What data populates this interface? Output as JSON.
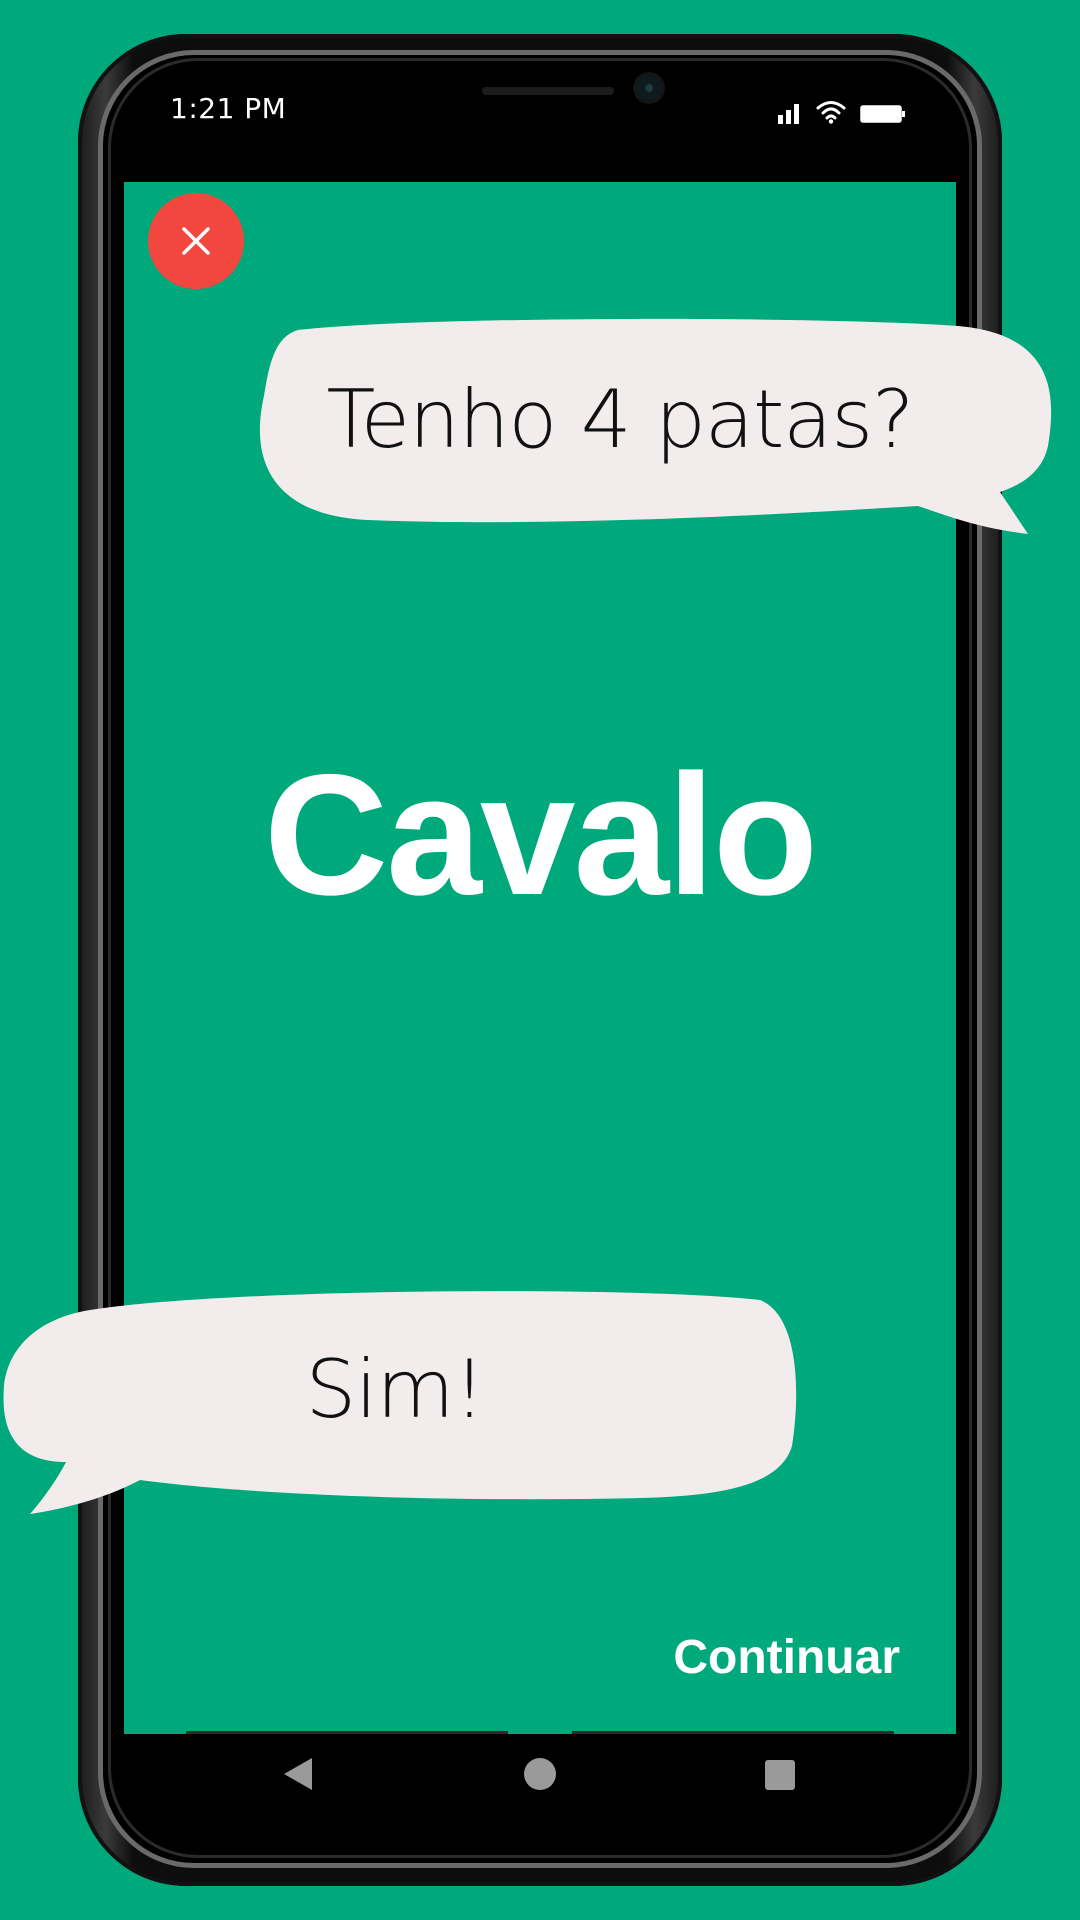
{
  "status_bar": {
    "time": "1:21 PM",
    "icons": [
      "signal-icon",
      "wifi-icon",
      "battery-icon"
    ]
  },
  "close_button": {
    "icon": "close-icon",
    "color": "#F2473F"
  },
  "question_bubble": {
    "text": "Tenho 4 patas?"
  },
  "main_word": "Cavalo",
  "answer_bubble": {
    "text": "Sim!"
  },
  "continue_button": {
    "label": "Continuar"
  },
  "navigation_bar": {
    "items": [
      "back-icon",
      "home-icon",
      "recents-icon"
    ]
  },
  "colors": {
    "background": "#00A97C",
    "bubble": "#F3ECEC",
    "text_dark": "#111111",
    "text_light": "#FFFFFF"
  }
}
